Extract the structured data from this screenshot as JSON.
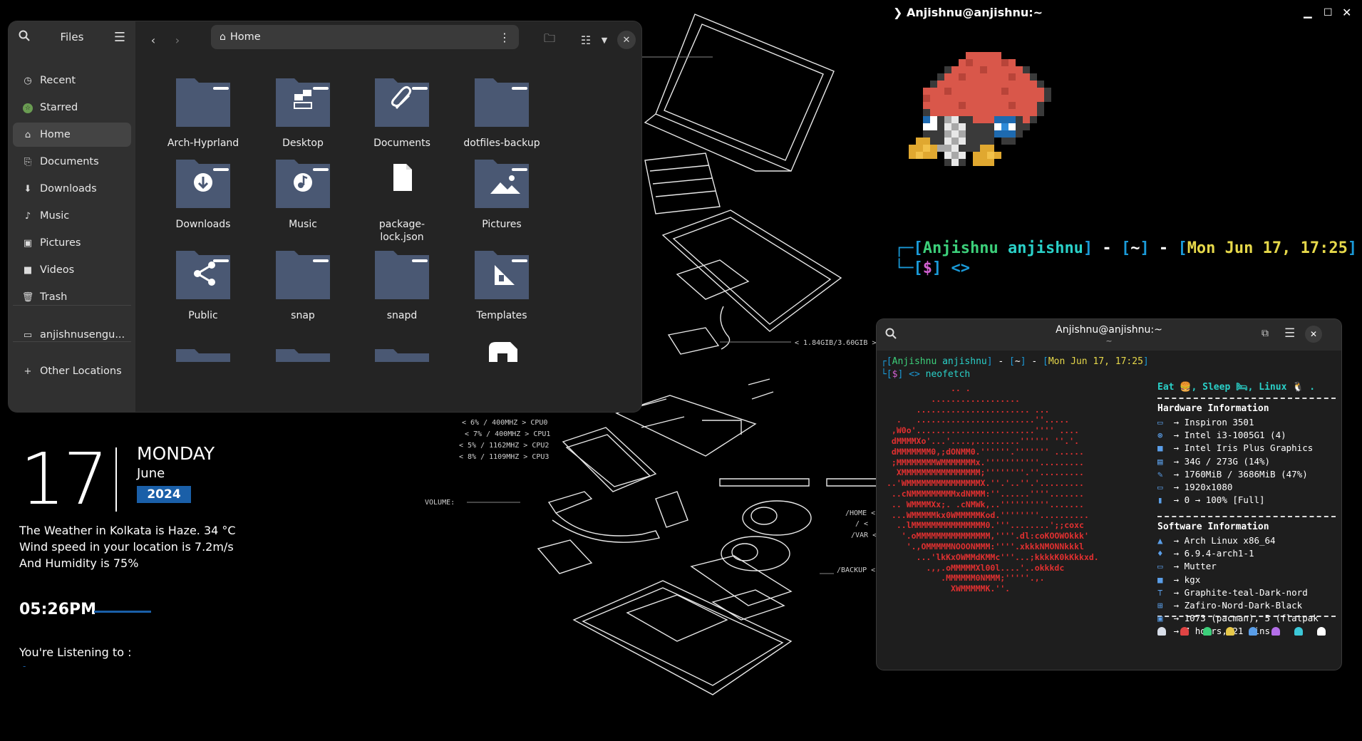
{
  "wallpaper": {
    "mem_label": "< 1.84GIB/3.60GIB >",
    "cpu_lines": [
      "< 6% / 400MHZ > CPU0",
      "< 7% / 400MHZ > CPU1",
      "< 5% / 1162MHZ > CPU2",
      "< 8% / 1109MHZ > CPU3"
    ],
    "volume_label": "VOLUME:",
    "home_label": "/HOME <",
    "root_label": "/ <",
    "var_label": "/VAR <",
    "backup_label": "/BACKUP <"
  },
  "files": {
    "title": "Files",
    "path": "Home",
    "sidebar": [
      {
        "label": "Recent",
        "icon": "clock-icon"
      },
      {
        "label": "Starred",
        "icon": "star-icon"
      },
      {
        "label": "Home",
        "icon": "home-icon",
        "active": true
      },
      {
        "label": "Documents",
        "icon": "document-icon"
      },
      {
        "label": "Downloads",
        "icon": "download-icon"
      },
      {
        "label": "Music",
        "icon": "music-icon"
      },
      {
        "label": "Pictures",
        "icon": "pictures-icon"
      },
      {
        "label": "Videos",
        "icon": "video-icon"
      },
      {
        "label": "Trash",
        "icon": "trash-icon"
      }
    ],
    "network_item": "anjishnusengu...",
    "other_locations": "Other Locations",
    "items": [
      {
        "label": "Arch-Hyprland",
        "kind": "folder"
      },
      {
        "label": "Desktop",
        "kind": "desktop"
      },
      {
        "label": "Documents",
        "kind": "documents"
      },
      {
        "label": "dotfiles-backup",
        "kind": "folder"
      },
      {
        "label": "Downloads",
        "kind": "downloads"
      },
      {
        "label": "Music",
        "kind": "music"
      },
      {
        "label": "package-\nlock.json",
        "kind": "file"
      },
      {
        "label": "Pictures",
        "kind": "pictures"
      },
      {
        "label": "Public",
        "kind": "public"
      },
      {
        "label": "snap",
        "kind": "folder"
      },
      {
        "label": "snapd",
        "kind": "folder"
      },
      {
        "label": "Templates",
        "kind": "templates"
      }
    ]
  },
  "widget": {
    "day_num": "17",
    "weekday": "MONDAY",
    "month": "June",
    "year": "2024",
    "weather": [
      "The Weather in Kolkata is Haze. 34 °C",
      "Wind speed in your location is 7.2m/s",
      "And Humidity is 75%"
    ],
    "time": "05:26PM",
    "listening": "You're Listening to :",
    "track": "-"
  },
  "term1": {
    "title": "Anjishnu@anjishnu:~",
    "prompt_user": "Anjishnu",
    "prompt_host": "anjishnu",
    "prompt_dir": "~",
    "prompt_date": "Mon Jun 17, 17:25",
    "prompt_dollar": "$",
    "prompt_arrow": "<>"
  },
  "term2": {
    "title": "Anjishnu@anjishnu:~",
    "subtitle": "~",
    "prompt_user": "Anjishnu",
    "prompt_host": "anjishnu",
    "prompt_dir": "~",
    "prompt_date": "Mon Jun 17, 17:25",
    "prompt_dollar": "$",
    "prompt_arrow": "<>",
    "command": "neofetch",
    "tagline": "Eat 🍔, Sleep 🛏, Linux 🐧 .",
    "hw_header": "Hardware Information",
    "hardware": [
      "Inspiron 3501",
      "Intel i3-1005G1 (4)",
      "Intel Iris Plus Graphics",
      "34G / 273G (14%)",
      "1760MiB / 3686MiB (47%)",
      "1920x1080",
      "0 → 100% [Full]"
    ],
    "sw_header": "Software Information",
    "software": [
      "Arch Linux x86_64",
      "6.9.4-arch1-1",
      "Mutter",
      "kgx",
      "Graphite-teal-Dark-nord",
      "Zafiro-Nord-Dark-Black",
      "1073 (pacman), 5 (flatpak",
      "7 hours, 21 mins"
    ],
    "ascii": [
      "             .. .",
      "         ..................",
      "      ....................... ...",
      "  .   ........................''.....",
      " ,W0o'........................'''' ....",
      " dMMMMXo'...'....,.........'''''' ''.'.",
      " dMMMMMMM0,;dONMM0.''''''.''''''' ......",
      " ;MMMMMMMMWMMMMMMMx.'''''''''''.........",
      "  XMMMMMMMMMMMMMMMM;''''''''.''.........",
      "..'WMMMMMMMMMMMMMMMX.''.'..''.'.........",
      " ..cNMMMMMMMMMxdNMMM:''......''''.......",
      " .. WMMMMXx;. .cNMWk,..''''''''''.......",
      " ...WMMMMMkx0WMMMMMKod.''''''''..........",
      "  ..lMMMMMMMMMMMMMMM0.'''........';;coxc",
      "   '.oMMMMMMMMMMMMMMM,''''.dl:coKOOWOkkk'",
      "    '.,OMMMMMNOOONMMM:''''.xkkkNMONNkkkl",
      "      ...'lkKxOWMMdKMMc'''...;kkkkK0kKkkxd.",
      "        .,,.oMMMMMXl00l....'..okkkdc",
      "           .MMMMMM0NMMM;'''''.,.",
      "             XWMMMMMK.''."
    ],
    "color_blocks": [
      "#d8dee9",
      "#e04444",
      "#3ccf7a",
      "#e6c84a",
      "#5a9ee8",
      "#b36ee8",
      "#3cc8d8",
      "#ffffff"
    ]
  },
  "colors": {
    "accent": "#1a5fa8",
    "teal": "#2ad1c9",
    "green": "#3ccf7a",
    "yellow": "#e6d84a",
    "magenta": "#d060d0",
    "folder": "#4a5873",
    "ascii_red": "#e03030"
  }
}
